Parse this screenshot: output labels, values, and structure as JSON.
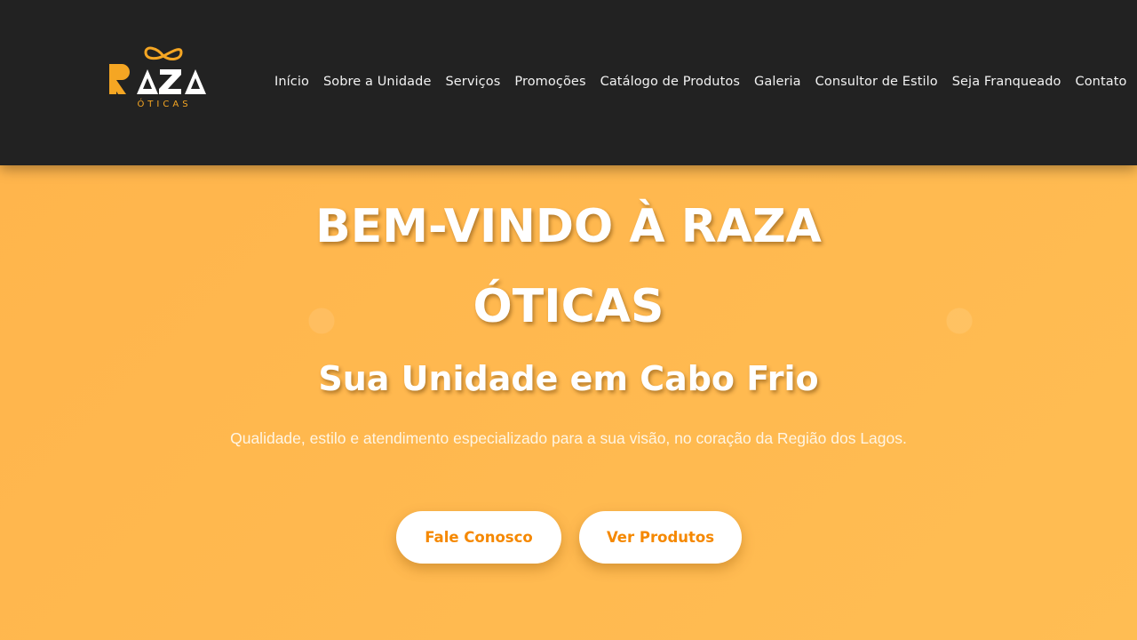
{
  "header": {
    "logo_text": "RAZA",
    "logo_subtext": "ÓTICAS",
    "nav": [
      {
        "label": "Início"
      },
      {
        "label": "Sobre a Unidade"
      },
      {
        "label": "Serviços"
      },
      {
        "label": "Promoções"
      },
      {
        "label": "Catálogo de Produtos"
      },
      {
        "label": "Galeria"
      },
      {
        "label": "Consultor de Estilo"
      },
      {
        "label": "Seja Franqueado"
      },
      {
        "label": "Contato"
      }
    ]
  },
  "hero": {
    "title": "BEM-VINDO À RAZA ÓTICAS",
    "subtitle": "Sua Unidade em Cabo Frio",
    "description": "Qualidade, estilo e atendimento especializado para a sua visão, no coração da Região dos Lagos.",
    "buttons": {
      "contact_label": "Fale Conosco",
      "products_label": "Ver Produtos"
    }
  },
  "colors": {
    "header_bg": "#222222",
    "hero_bg": "#ffb84f",
    "brand_orange": "#f5a623",
    "button_text": "#f58800"
  }
}
